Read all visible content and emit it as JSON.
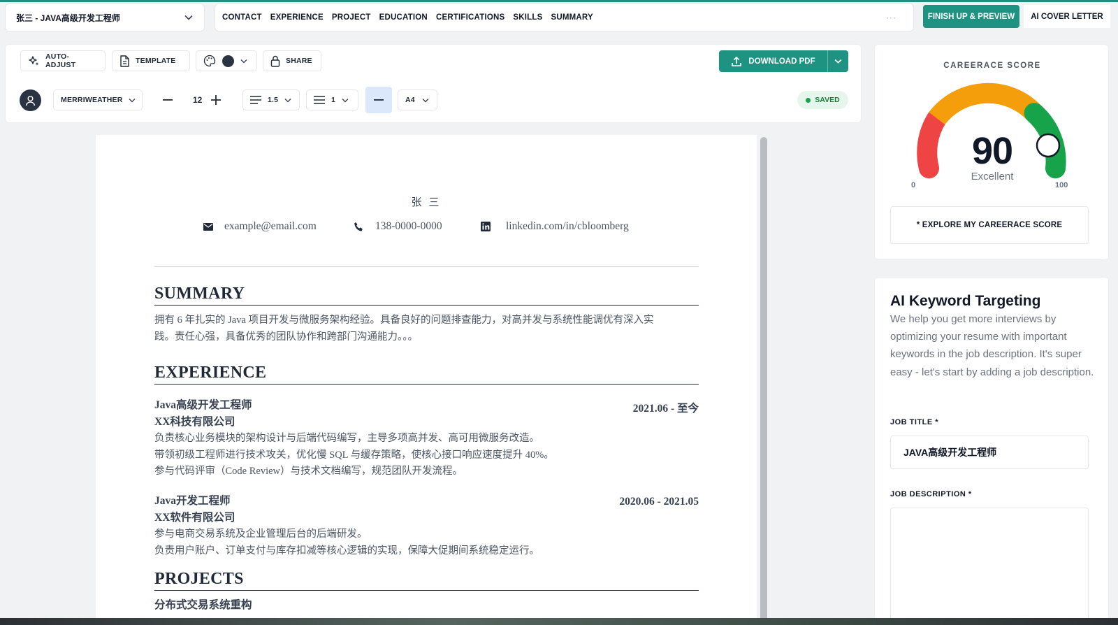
{
  "document_selector": {
    "label": "张三 - JAVA高级开发工程师"
  },
  "nav": {
    "links": [
      "CONTACT",
      "EXPERIENCE",
      "PROJECT",
      "EDUCATION",
      "CERTIFICATIONS",
      "SKILLS",
      "SUMMARY"
    ],
    "more": "···",
    "finish_label": "FINISH UP & PREVIEW",
    "cover_label": "AI COVER LETTER"
  },
  "toolbar": {
    "auto_adjust": "AUTO-ADJUST",
    "template": "TEMPLATE",
    "share": "SHARE",
    "download": "DOWNLOAD PDF",
    "font": "MERRIWEATHER",
    "font_size": "12",
    "line_spacing": "1.5",
    "paragraph_spacing": "1",
    "page_size": "A4",
    "saved": "SAVED",
    "theme_color": "#2a3341",
    "accent_color": "#1f9382"
  },
  "resume": {
    "name": "张 三",
    "email": "example@email.com",
    "phone": "138-0000-0000",
    "linkedin": "linkedin.com/in/cbloomberg",
    "summary_heading": "SUMMARY",
    "summary_lines": [
      "拥有 6 年扎实的 Java 项目开发与微服务架构经验。具备良好的问题排查能力，对高并发与系统性能调优有深入实",
      "践。责任心强，具备优秀的团队协作和跨部门沟通能力。。。"
    ],
    "experience_heading": "EXPERIENCE",
    "jobs": [
      {
        "title": "Java高级开发工程师",
        "date": "2021.06 - 至今",
        "company": "XX科技有限公司",
        "lines": [
          "负责核心业务模块的架构设计与后端代码编写，主导多项高并发、高可用微服务改造。",
          "带领初级工程师进行技术攻关，优化慢 SQL 与缓存策略，使核心接口响应速度提升 40%。",
          "参与代码评审（Code Review）与技术文档编写，规范团队开发流程。"
        ]
      },
      {
        "title": "Java开发工程师",
        "date": "2020.06 - 2021.05",
        "company": "XX软件有限公司",
        "lines": [
          "参与电商交易系统及企业管理后台的后端研发。",
          "负责用户账户、订单支付与库存扣减等核心逻辑的实现，保障大促期间系统稳定运行。"
        ]
      }
    ],
    "projects_heading": "PROJECTS",
    "project_first": "分布式交易系统重构"
  },
  "score": {
    "title": "CAREERACE SCORE",
    "value": 90,
    "label": "Excellent",
    "min": "0",
    "max": "100",
    "explore": "* EXPLORE MY CAREERACE SCORE"
  },
  "keyword": {
    "title": "AI Keyword Targeting",
    "description": "We help you get more interviews by optimizing your resume with important keywords in the job description. It's super easy - let's start by adding a job description.",
    "job_title_label": "JOB TITLE *",
    "job_title_value": "JAVA高级开发工程师",
    "job_desc_label": "JOB DESCRIPTION *",
    "job_desc_value": ""
  }
}
